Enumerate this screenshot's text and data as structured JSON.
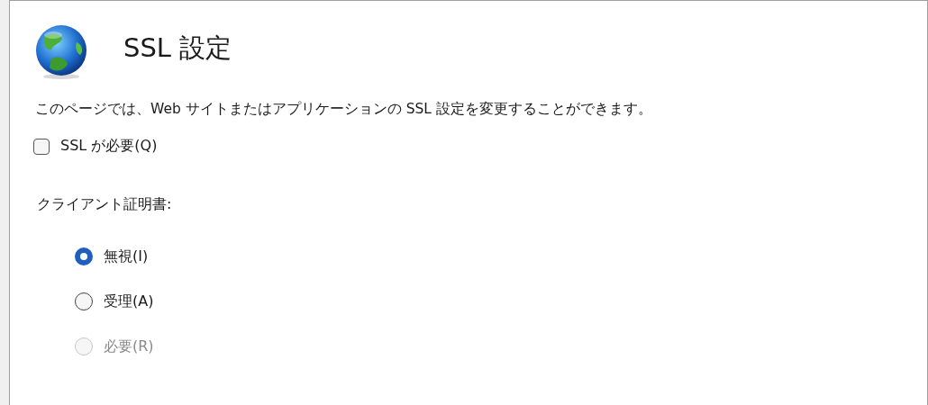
{
  "header": {
    "title": "SSL 設定"
  },
  "description": "このページでは、Web サイトまたはアプリケーションの SSL 設定を変更することができます。",
  "require_ssl": {
    "label": "SSL が必要(Q)",
    "checked": false
  },
  "client_certificates": {
    "label": "クライアント証明書:",
    "options": [
      {
        "label": "無視(I)",
        "selected": true,
        "disabled": false
      },
      {
        "label": "受理(A)",
        "selected": false,
        "disabled": false
      },
      {
        "label": "必要(R)",
        "selected": false,
        "disabled": true
      }
    ]
  }
}
